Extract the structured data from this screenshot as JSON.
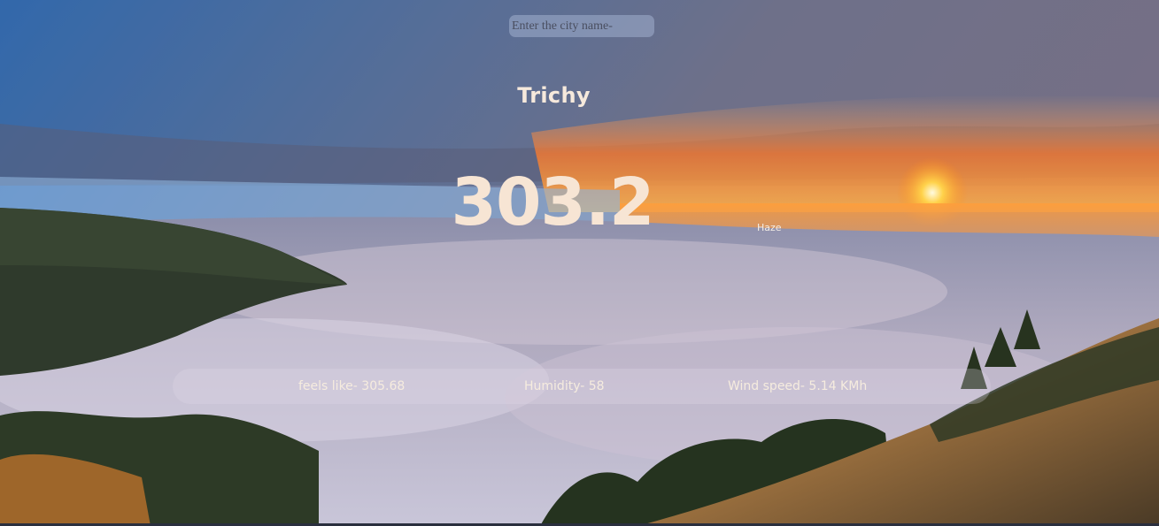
{
  "search": {
    "placeholder": "Enter the city name-",
    "value": ""
  },
  "weather": {
    "city": "Trichy",
    "temperature": "303.2",
    "condition": "Haze",
    "feels_like": "feels like- 305.68",
    "humidity": "Humidity- 58",
    "wind_speed": "Wind speed- 5.14 KMh"
  },
  "background": {
    "description_icon": "landscape-background",
    "colors": {
      "sky_top": "#3a6fb8",
      "sunset": "#ff8a1a",
      "clouds": "#b9b2c8",
      "forest": "#2e3a2a"
    }
  }
}
